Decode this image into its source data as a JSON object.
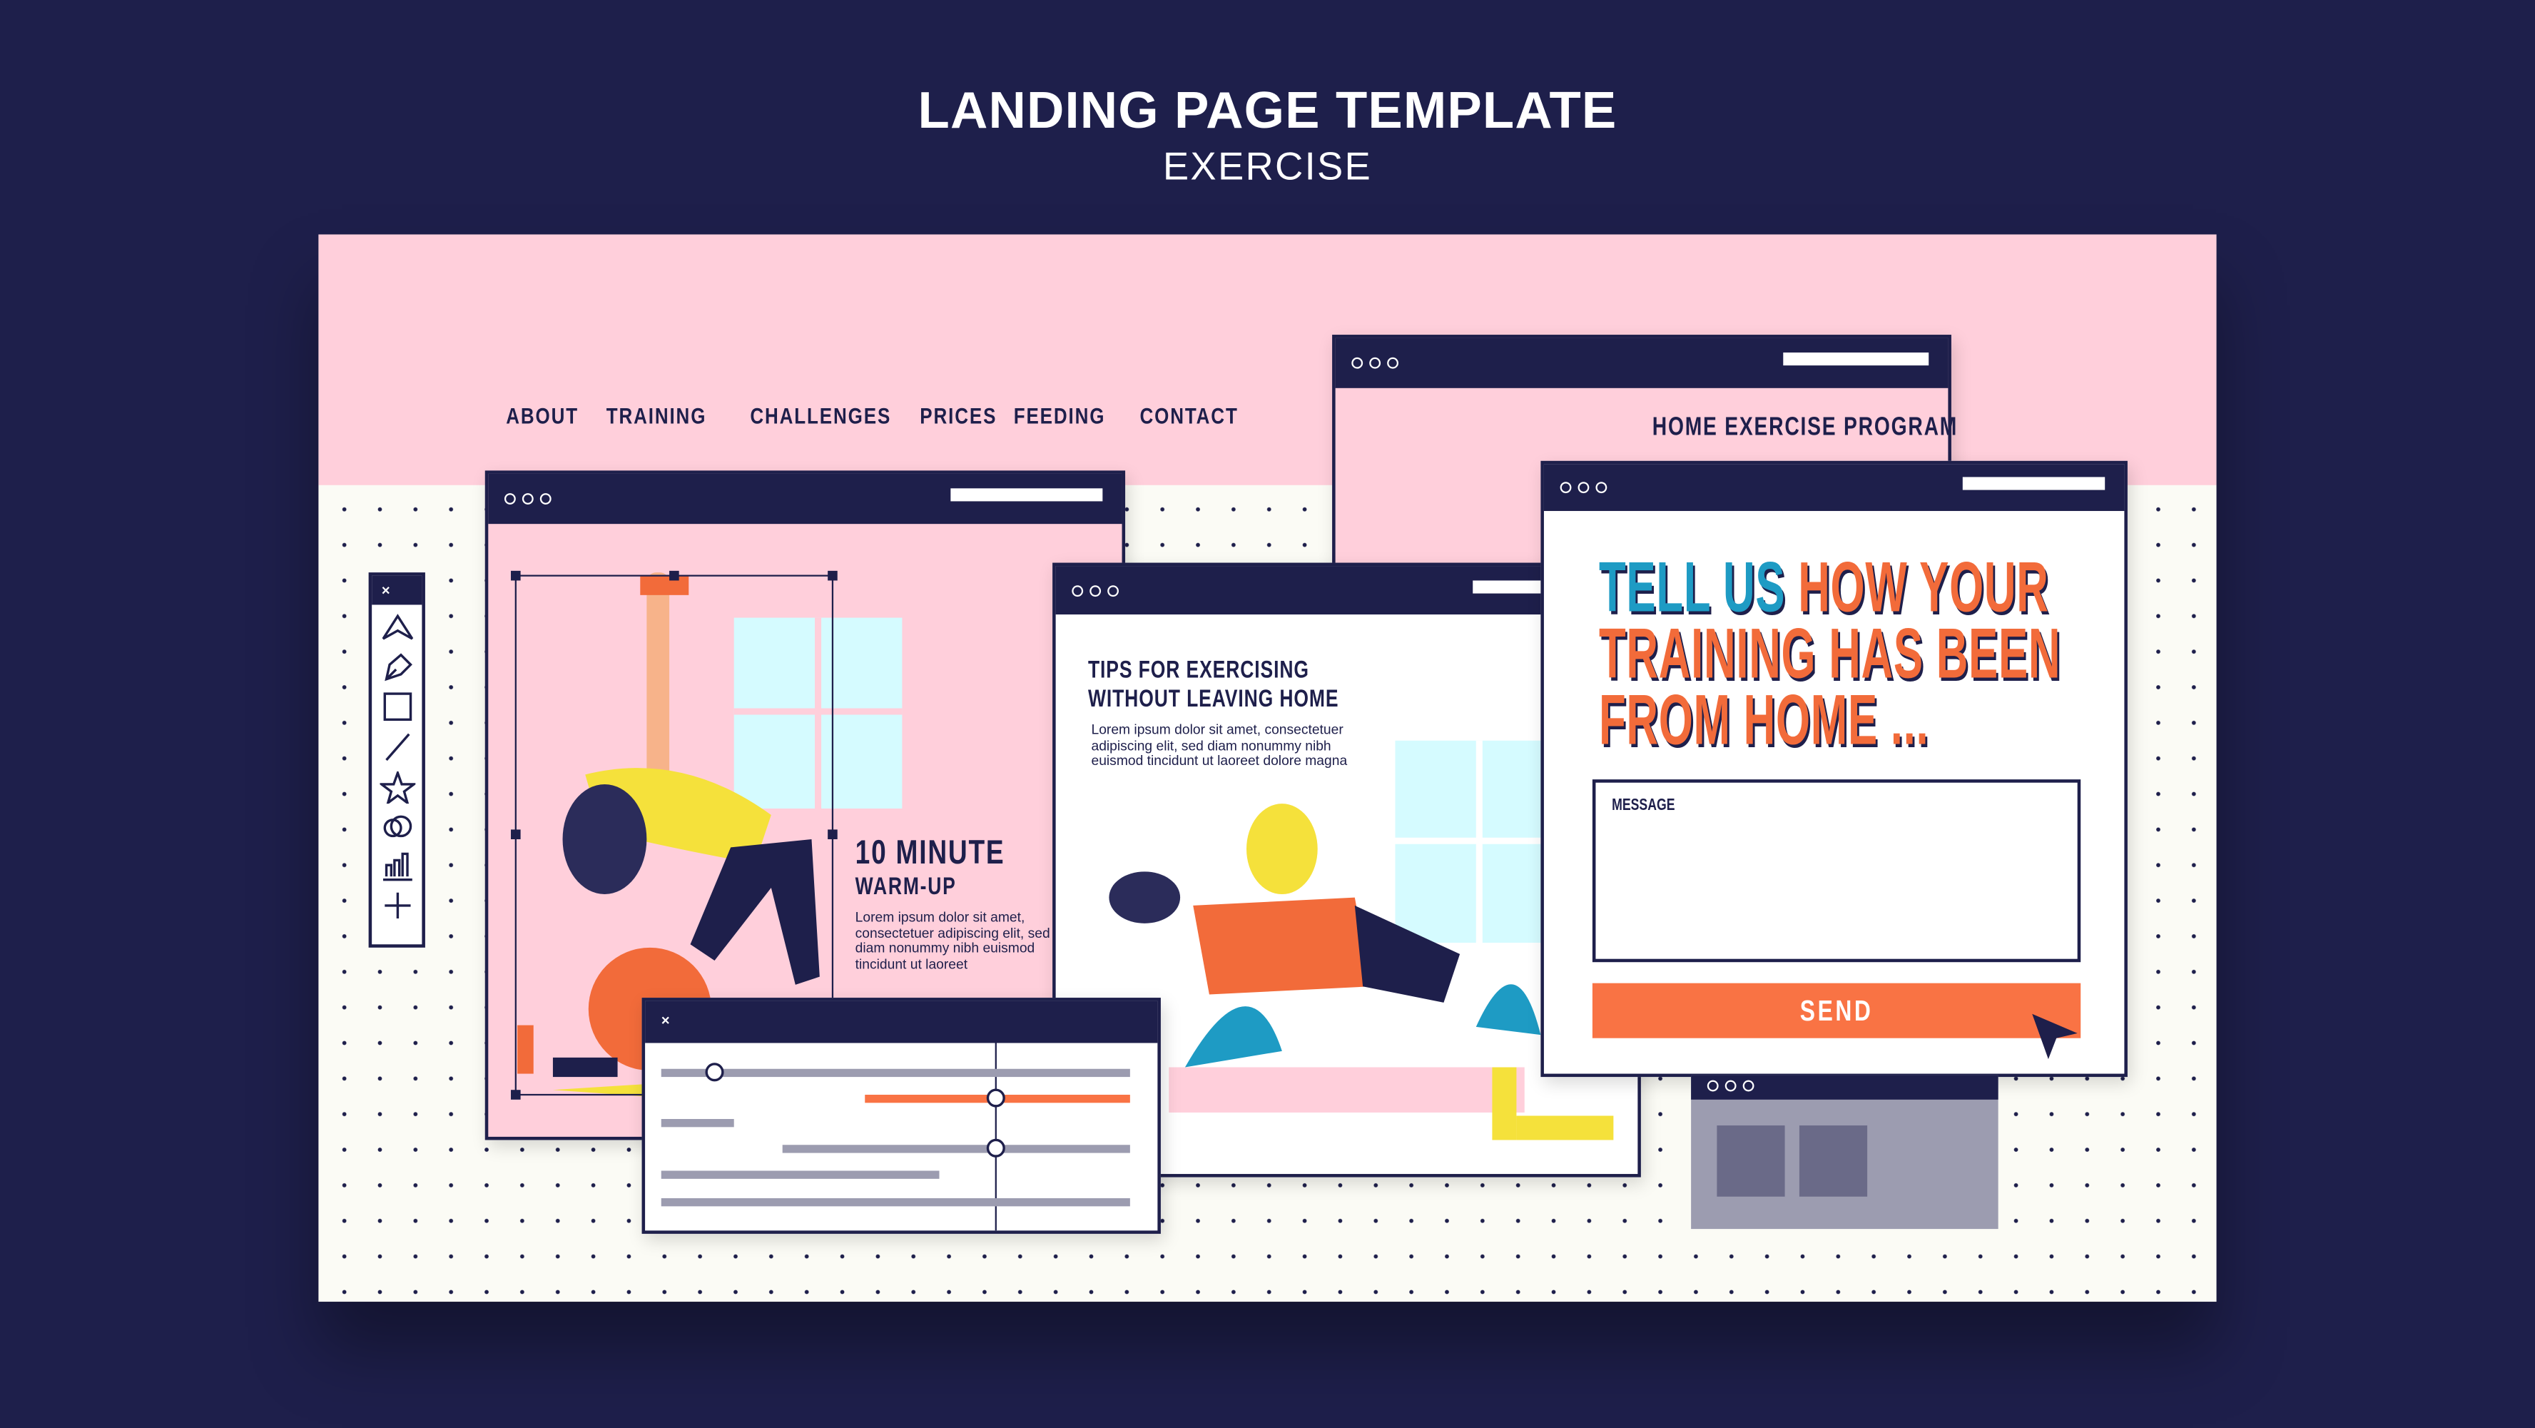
{
  "header": {
    "title": "LANDING PAGE TEMPLATE",
    "subtitle": "EXERCISE"
  },
  "nav": {
    "items": [
      "ABOUT",
      "TRAINING",
      "CHALLENGES",
      "PRICES",
      "FEEDING",
      "CONTACT"
    ]
  },
  "program_window": {
    "title": "HOME EXERCISE PROGRAM"
  },
  "warmup_window": {
    "heading": "10 MINUTE",
    "subheading": "WARM-UP",
    "body": "Lorem ipsum dolor sit amet, consectetuer adipiscing elit, sed diam nonummy nibh euismod tincidunt ut  laoreet"
  },
  "tips_window": {
    "heading_line1": "TIPS FOR EXERCISING",
    "heading_line2": "WITHOUT LEAVING HOME",
    "body": "Lorem ipsum dolor sit amet, consectetuer adipiscing elit, sed diam nonummy nibh euismod tincidunt ut  laoreet dolore magna"
  },
  "feedback_window": {
    "line1_a": "TELL US",
    "line1_b": "HOW YOUR",
    "line2": "TRAINING HAS BEEN",
    "line3": "FROM HOME ...",
    "message_label": "MESSAGE",
    "send_label": "SEND"
  },
  "toolbar": {
    "close": "×",
    "tools": [
      "select-arrow-icon",
      "pen-icon",
      "rectangle-icon",
      "line-icon",
      "star-icon",
      "circles-icon",
      "bar-chart-icon",
      "plus-icon"
    ]
  },
  "slider_panel": {
    "close": "×"
  },
  "colors": {
    "navy": "#1e1f4b",
    "pink": "#ffcfdb",
    "orange": "#f97344",
    "teal": "#1e9bc4",
    "gray": "#9c9cb0"
  }
}
